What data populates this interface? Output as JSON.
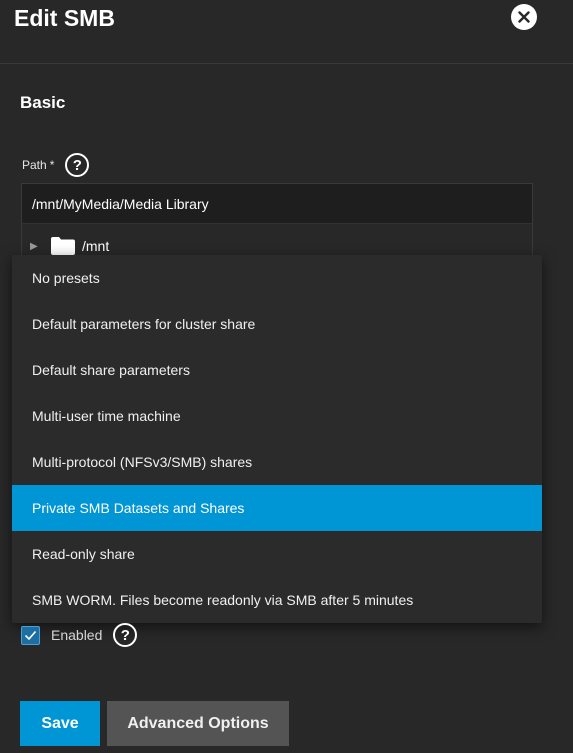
{
  "dialog": {
    "title": "Edit SMB"
  },
  "section": {
    "title": "Basic"
  },
  "path": {
    "label": "Path",
    "required_mark": "*",
    "value": "/mnt/MyMedia/Media Library",
    "tree_root": "/mnt"
  },
  "preset_menu": {
    "items": [
      "No presets",
      "Default parameters for cluster share",
      "Default share parameters",
      "Multi-user time machine",
      "Multi-protocol (NFSv3/SMB) shares",
      "Private SMB Datasets and Shares",
      "Read-only share",
      "SMB WORM. Files become readonly via SMB after 5 minutes"
    ],
    "selected_index": 5
  },
  "enabled": {
    "label": "Enabled",
    "checked": true
  },
  "buttons": {
    "save": "Save",
    "advanced": "Advanced Options"
  },
  "help_glyph": "?",
  "tree_arrow_glyph": "▶",
  "colors": {
    "background": "#282828",
    "accent": "#0095d5",
    "secondary_button": "#545454"
  }
}
